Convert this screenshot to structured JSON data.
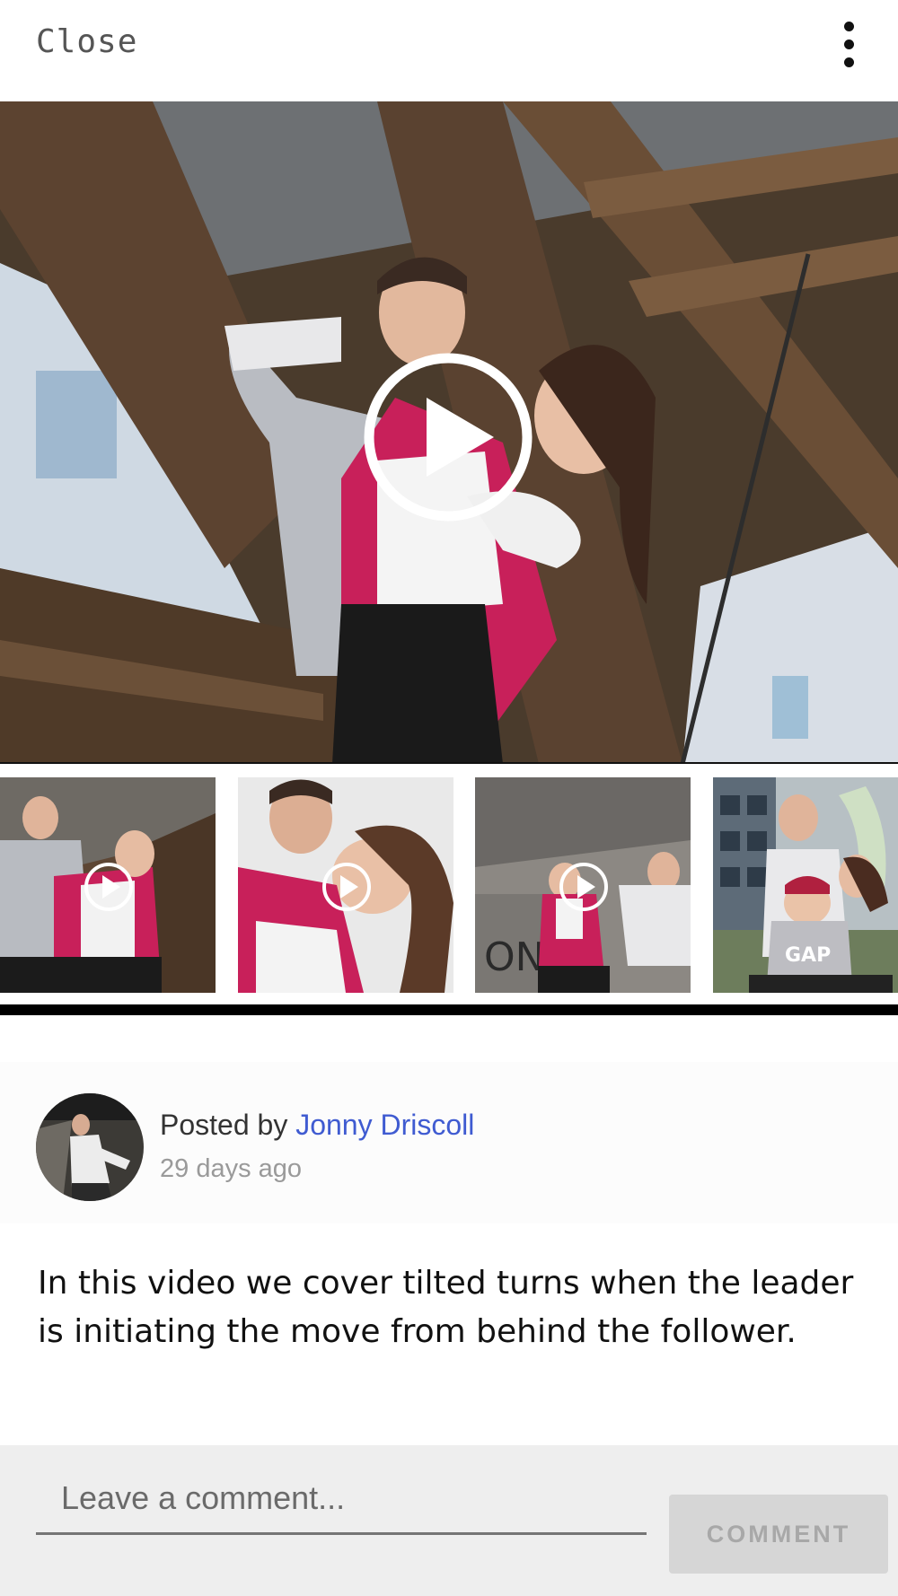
{
  "topbar": {
    "close_label": "Close",
    "more_icon": "more-vert-icon"
  },
  "video": {
    "play_icon": "play-circle-icon"
  },
  "thumbnails": [
    {
      "play_icon": "play-circle-icon"
    },
    {
      "play_icon": "play-circle-icon"
    },
    {
      "play_icon": "play-circle-icon"
    },
    {
      "play_icon": null
    }
  ],
  "post": {
    "posted_by_label": "Posted by ",
    "author": "Jonny Driscoll",
    "time_ago": "29 days ago",
    "description": "In this video we cover tilted turns when the leader is initiating the move from behind the follower."
  },
  "comment": {
    "placeholder": "Leave a comment...",
    "button_label": "COMMENT"
  },
  "colors": {
    "link": "#3f5bd1",
    "comment_button_bg": "#d6d6d6",
    "jacket_pink": "#c8205a"
  }
}
